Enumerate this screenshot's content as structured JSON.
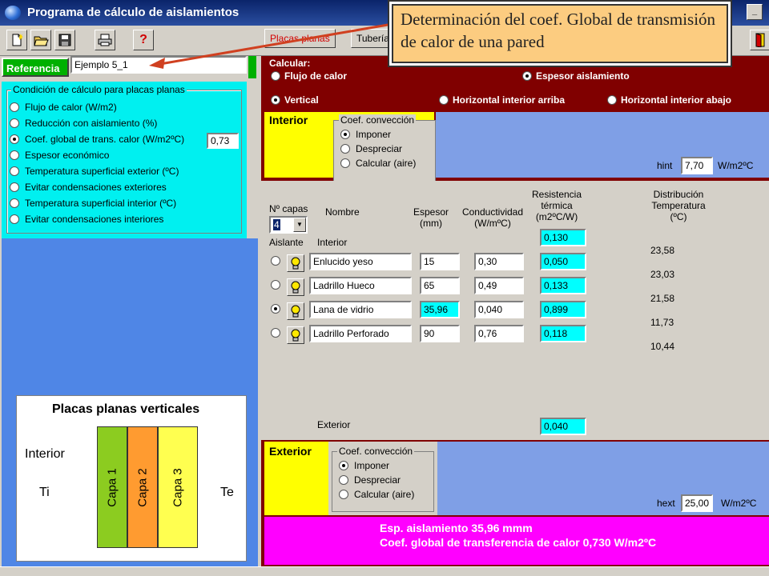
{
  "window": {
    "title": "Programa de cálculo de aislamientos"
  },
  "toolbar": {
    "help_glyph": "?"
  },
  "tabs": [
    {
      "label": "Placas planas"
    },
    {
      "label": "Tuberías"
    }
  ],
  "callout": {
    "text": "Determinación del coef. Global de transmisión de calor de una pared"
  },
  "reference": {
    "label": "Referencia",
    "value": "Ejemplo 5_1"
  },
  "conditions": {
    "legend": "Condición de cálculo para placas planas",
    "options": [
      "Flujo de calor  (W/m2)",
      "Reducción con aislamiento (%)",
      "Coef. global de trans. calor (W/m2ºC)",
      "Espesor económico",
      "Temperatura superficial exterior (ºC)",
      "Evitar condensaciones exteriores",
      "Temperatura superficial interior (ºC)",
      "Evitar condensaciones interiores"
    ],
    "selected_index": 2,
    "coef_value": "0,73"
  },
  "calcular": {
    "label": "Calcular:",
    "options": [
      "Flujo de calor",
      "Espesor aislamiento"
    ],
    "selected_index": 1
  },
  "orientation": {
    "options": [
      "Vertical",
      "Horizontal interior arriba",
      "Horizontal interior abajo"
    ],
    "selected_index": 0
  },
  "interior": {
    "title": "Interior",
    "conv_legend": "Coef. convección",
    "conv_options": [
      "Imponer",
      "Despreciar",
      "Calcular (aire)"
    ],
    "conv_selected": 0,
    "h_label": "hint",
    "h_value": "7,70",
    "h_unit": "W/m2ºC"
  },
  "layers": {
    "n_label": "Nº capas",
    "n_value": "4",
    "headers": {
      "aislante": "Aislante",
      "nombre": "Nombre",
      "espesor": "Espesor (mm)",
      "conductividad": "Conductividad (W/mºC)",
      "resistencia": "Resistencia térmica (m2ºC/W)",
      "distribucion": "Distribución Temperatura (ºC)"
    },
    "interior_label": "Interior",
    "interior_resistance": "0,130",
    "exterior_label": "Exterior",
    "exterior_resistance": "0,040",
    "insulation_index": 2,
    "rows": [
      {
        "name": "Enlucido yeso",
        "thickness": "15",
        "conductivity": "0,30",
        "resistance": "0,050"
      },
      {
        "name": "Ladrillo Hueco",
        "thickness": "65",
        "conductivity": "0,49",
        "resistance": "0,133"
      },
      {
        "name": "Lana de vidrio",
        "thickness": "35,96",
        "conductivity": "0,040",
        "resistance": "0,899"
      },
      {
        "name": "Ladrillo Perforado",
        "thickness": "90",
        "conductivity": "0,76",
        "resistance": "0,118"
      }
    ],
    "temperatures": [
      "23,58",
      "23,03",
      "21,58",
      "11,73",
      "10,44"
    ]
  },
  "exterior": {
    "title": "Exterior",
    "conv_legend": "Coef. convección",
    "conv_options": [
      "Imponer",
      "Despreciar",
      "Calcular (aire)"
    ],
    "conv_selected": 0,
    "h_label": "hext",
    "h_value": "25,00",
    "h_unit": "W/m2ºC"
  },
  "results": {
    "line1": "Esp. aislamiento 35,96 mmm",
    "line2": "Coef. global de transferencia de calor 0,730 W/m2ºC"
  },
  "diagram": {
    "title": "Placas planas verticales",
    "interior": "Interior",
    "ti": "Ti",
    "te": "Te",
    "layers": [
      "Capa 1",
      "Capa 2",
      "Capa 3"
    ]
  },
  "colors": {
    "titlebar": "#0a246a",
    "reference_green": "#00b000",
    "panel_cyan": "#00f0f0",
    "header_maroon": "#800000",
    "section_yellow": "#ffff00",
    "result_magenta": "#ff00ff",
    "capa1": "#8ccc20",
    "capa2": "#ff9b30",
    "capa3": "#ffff50",
    "arrow": "#d04020"
  }
}
